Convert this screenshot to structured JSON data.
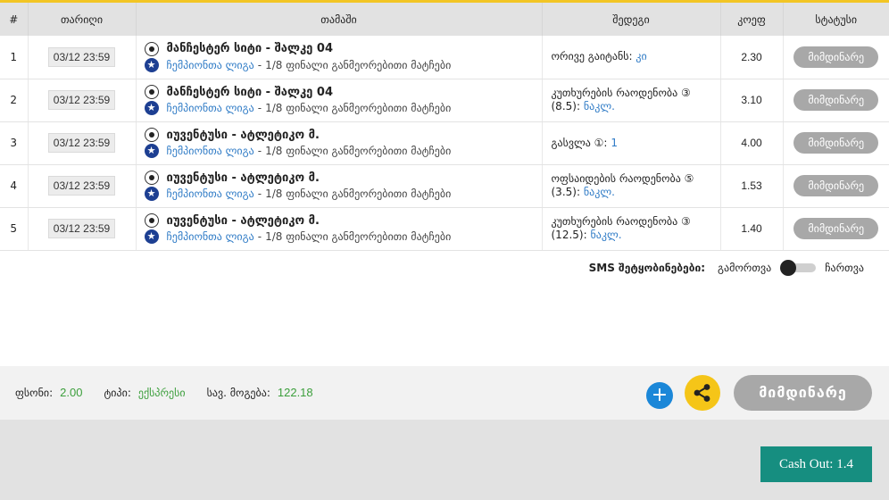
{
  "table": {
    "headers": {
      "num": "#",
      "date": "თარიღი",
      "match": "თამაში",
      "event": "შედეგი",
      "coef": "კოეფ",
      "status": "სტატუსი"
    },
    "rows": [
      {
        "num": "1",
        "date": "03/12 23:59",
        "match": "მანჩესტერ სიტი - შალკე 04",
        "league": "ჩემპიონთა ლიგა",
        "stage": "1/8 ფინალი განმეორებითი მატჩები",
        "event_label": "ორივე გაიტანს:",
        "event_value": "კი",
        "coef": "2.30",
        "status": "მიმდინარე"
      },
      {
        "num": "2",
        "date": "03/12 23:59",
        "match": "მანჩესტერ სიტი - შალკე 04",
        "league": "ჩემპიონთა ლიგა",
        "stage": "1/8 ფინალი განმეორებითი მატჩები",
        "event_label": "კუთხურების რაოდენობა ③ (8.5):",
        "event_value": "ნაკლ.",
        "coef": "3.10",
        "status": "მიმდინარე"
      },
      {
        "num": "3",
        "date": "03/12 23:59",
        "match": "იუვენტუსი - ატლეტიკო მ.",
        "league": "ჩემპიონთა ლიგა",
        "stage": "1/8 ფინალი განმეორებითი მატჩები",
        "event_label": "გასვლა ①:",
        "event_value": "1",
        "coef": "4.00",
        "status": "მიმდინარე"
      },
      {
        "num": "4",
        "date": "03/12 23:59",
        "match": "იუვენტუსი - ატლეტიკო მ.",
        "league": "ჩემპიონთა ლიგა",
        "stage": "1/8 ფინალი განმეორებითი მატჩები",
        "event_label": "ოფსაიდების რაოდენობა ⑤ (3.5):",
        "event_value": "ნაკლ.",
        "coef": "1.53",
        "status": "მიმდინარე"
      },
      {
        "num": "5",
        "date": "03/12 23:59",
        "match": "იუვენტუსი - ატლეტიკო მ.",
        "league": "ჩემპიონთა ლიგა",
        "stage": "1/8 ფინალი განმეორებითი მატჩები",
        "event_label": "კუთხურების რაოდენობა ③ (12.5):",
        "event_value": "ნაკლ.",
        "coef": "1.40",
        "status": "მიმდინარე"
      }
    ]
  },
  "sms": {
    "label": "SMS შეტყობინებები:",
    "off_label": "გამორთვა",
    "on_label": "ჩართვა",
    "enabled": false
  },
  "summary": {
    "price_label": "ფსონი:",
    "price_value": "2.00",
    "type_label": "ტიპი:",
    "type_value": "ექსპრესი",
    "payout_label": "სავ. მოგება:",
    "payout_value": "122.18"
  },
  "actions": {
    "plus_label": "+",
    "status_label": "მიმდინარე",
    "cashout_label": "Cash Out: 1.4"
  },
  "colors": {
    "accent_yellow": "#f5c518",
    "blue": "#1b87d8",
    "green_value": "#3c9f3c",
    "cashout": "#168e80",
    "status_gray": "#a8a8a8"
  }
}
